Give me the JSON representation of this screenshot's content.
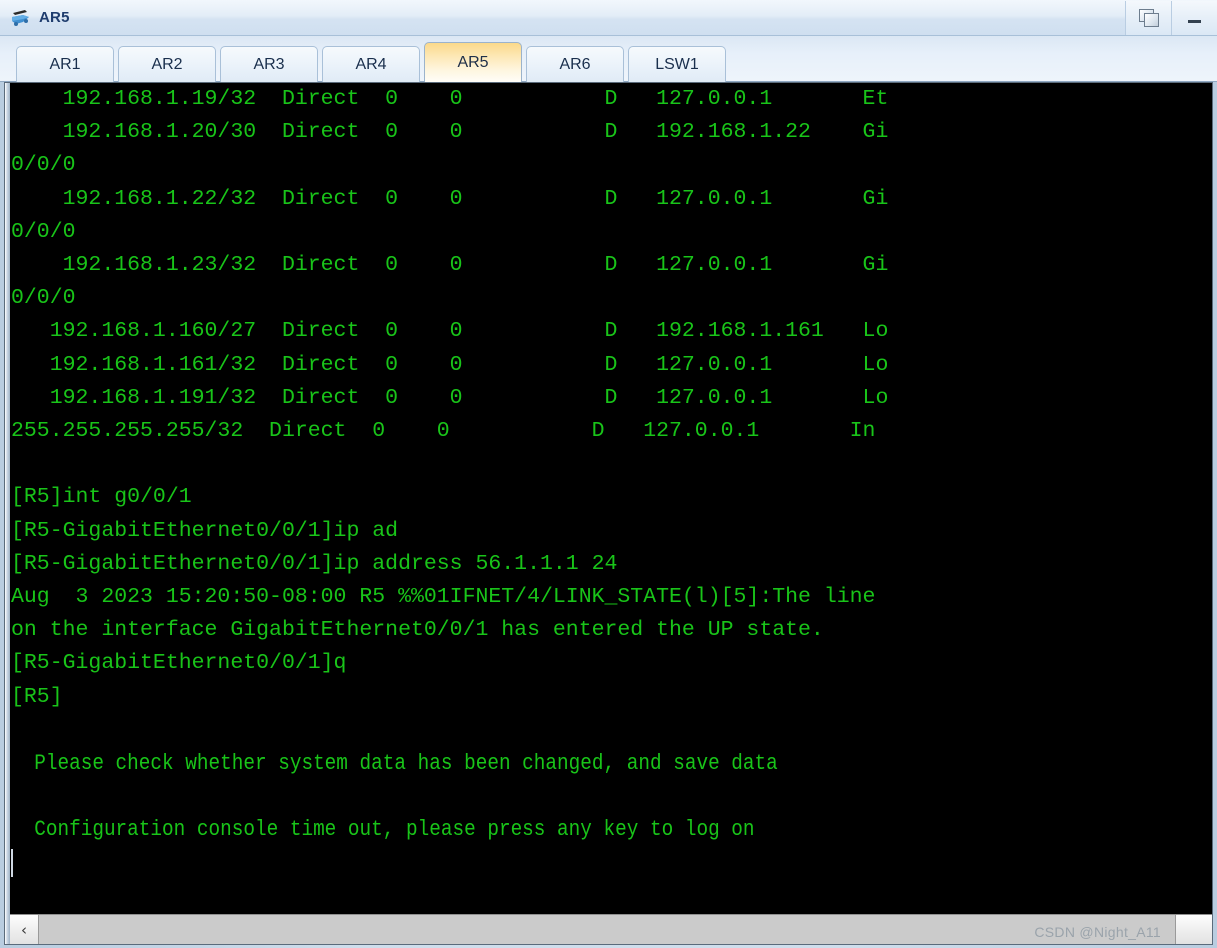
{
  "window": {
    "title": "AR5",
    "icon": "router-icon",
    "buttons": [
      {
        "name": "restore-button",
        "icon": "restore-windows-icon",
        "label": ""
      },
      {
        "name": "minimize-button",
        "icon": "minimize-icon",
        "label": ""
      }
    ]
  },
  "tabs": [
    {
      "label": "AR1",
      "active": false
    },
    {
      "label": "AR2",
      "active": false
    },
    {
      "label": "AR3",
      "active": false
    },
    {
      "label": "AR4",
      "active": false
    },
    {
      "label": "AR5",
      "active": true
    },
    {
      "label": "AR6",
      "active": false
    },
    {
      "label": "LSW1",
      "active": false
    }
  ],
  "console": {
    "foreground_color": "#19c419",
    "background_color": "#000000",
    "lines": [
      {
        "text": "    192.168.1.19/32  Direct  0    0           D   127.0.0.1       Et",
        "style": "normal"
      },
      {
        "text": "    192.168.1.20/30  Direct  0    0           D   192.168.1.22    Gi",
        "style": "normal"
      },
      {
        "text": "0/0/0",
        "style": "normal"
      },
      {
        "text": "    192.168.1.22/32  Direct  0    0           D   127.0.0.1       Gi",
        "style": "normal"
      },
      {
        "text": "0/0/0",
        "style": "normal"
      },
      {
        "text": "    192.168.1.23/32  Direct  0    0           D   127.0.0.1       Gi",
        "style": "normal"
      },
      {
        "text": "0/0/0",
        "style": "normal"
      },
      {
        "text": "   192.168.1.160/27  Direct  0    0           D   192.168.1.161   Lo",
        "style": "normal"
      },
      {
        "text": "   192.168.1.161/32  Direct  0    0           D   127.0.0.1       Lo",
        "style": "normal"
      },
      {
        "text": "   192.168.1.191/32  Direct  0    0           D   127.0.0.1       Lo",
        "style": "normal"
      },
      {
        "text": "255.255.255.255/32  Direct  0    0           D   127.0.0.1       In",
        "style": "normal"
      },
      {
        "text": "",
        "style": "blank"
      },
      {
        "text": "[R5]int g0/0/1",
        "style": "normal"
      },
      {
        "text": "[R5-GigabitEthernet0/0/1]ip ad",
        "style": "normal"
      },
      {
        "text": "[R5-GigabitEthernet0/0/1]ip address 56.1.1.1 24",
        "style": "normal"
      },
      {
        "text": "Aug  3 2023 15:20:50-08:00 R5 %%01IFNET/4/LINK_STATE(l)[5]:The line",
        "style": "normal"
      },
      {
        "text": "on the interface GigabitEthernet0/0/1 has entered the UP state.",
        "style": "normal"
      },
      {
        "text": "[R5-GigabitEthernet0/0/1]q",
        "style": "normal"
      },
      {
        "text": "[R5]",
        "style": "normal"
      },
      {
        "text": "",
        "style": "blank"
      },
      {
        "text": "  Please check whether system data has been changed, and save data",
        "style": "narrow"
      },
      {
        "text": "",
        "style": "blank"
      },
      {
        "text": "  Configuration console time out, please press any key to log on",
        "style": "narrow"
      }
    ],
    "cursor_visible": true
  },
  "scrollbar": {
    "left_arrow_glyph": "‹",
    "name": "horizontal-scrollbar"
  },
  "watermark": {
    "text": "CSDN @Night_A11"
  }
}
